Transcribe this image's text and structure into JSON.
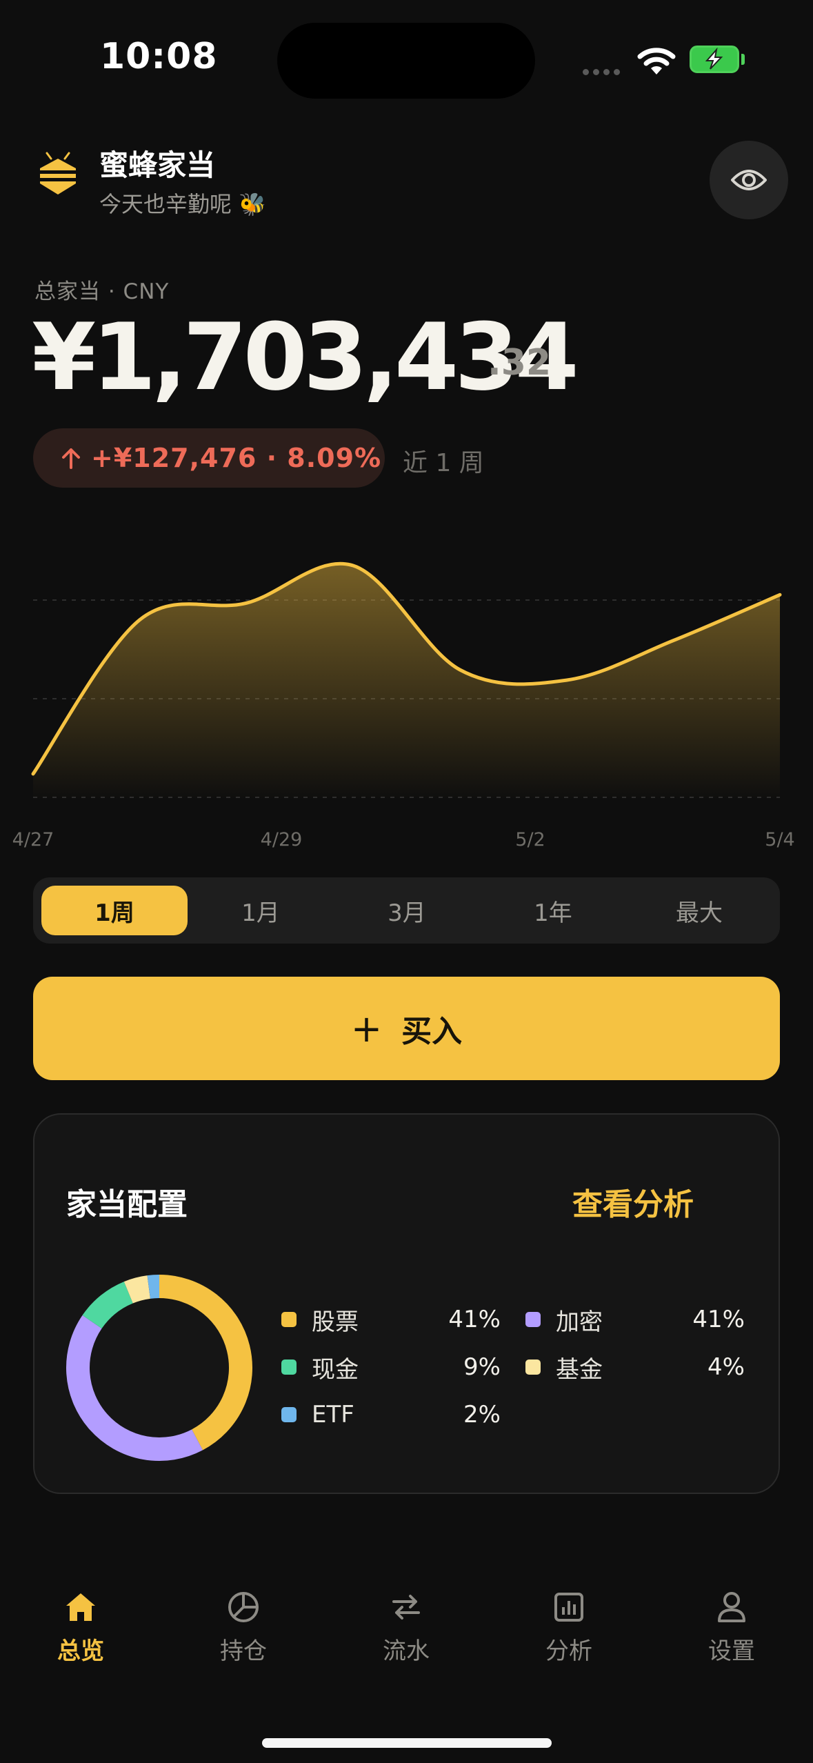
{
  "status_bar": {
    "time": "10:08"
  },
  "header": {
    "title": "蜜蜂家当",
    "subtitle": "今天也辛勤呢 🐝"
  },
  "balance": {
    "label": "总家当 · CNY",
    "integer": "¥1,703,434",
    "decimal": ".32",
    "change": "+¥127,476 · 8.09%",
    "period": "近 1 周"
  },
  "chart_data": {
    "type": "area",
    "x": [
      "4/27",
      "4/28",
      "4/29",
      "4/30",
      "5/1",
      "5/2",
      "5/3",
      "5/4"
    ],
    "y": [
      0.0,
      0.74,
      0.82,
      1.0,
      0.5,
      0.45,
      0.64,
      0.86
    ],
    "x_tick_labels": [
      "4/27",
      "4/29",
      "5/2",
      "5/4"
    ],
    "color": "#f5c242",
    "grid": "dashed horizontal"
  },
  "periods": {
    "items": [
      "1周",
      "1月",
      "3月",
      "1年",
      "最大"
    ],
    "selected": "1周"
  },
  "buy_button": {
    "label": "买入"
  },
  "allocation": {
    "title": "家当配置",
    "link": "查看分析",
    "items": [
      {
        "name": "股票",
        "percent": "41%",
        "value": 41,
        "color": "#f5c242"
      },
      {
        "name": "加密",
        "percent": "41%",
        "value": 41,
        "color": "#b39dff"
      },
      {
        "name": "现金",
        "percent": "9%",
        "value": 9,
        "color": "#4fd8a0"
      },
      {
        "name": "基金",
        "percent": "4%",
        "value": 4,
        "color": "#fbe6a0"
      },
      {
        "name": "ETF",
        "percent": "2%",
        "value": 2,
        "color": "#6fb6ec"
      }
    ]
  },
  "tab_bar": {
    "items": [
      {
        "label": "总览",
        "icon": "home-icon",
        "active": true
      },
      {
        "label": "持仓",
        "icon": "pie-icon",
        "active": false
      },
      {
        "label": "流水",
        "icon": "transfer-icon",
        "active": false
      },
      {
        "label": "分析",
        "icon": "analytics-icon",
        "active": false
      },
      {
        "label": "设置",
        "icon": "person-icon",
        "active": false
      }
    ]
  }
}
